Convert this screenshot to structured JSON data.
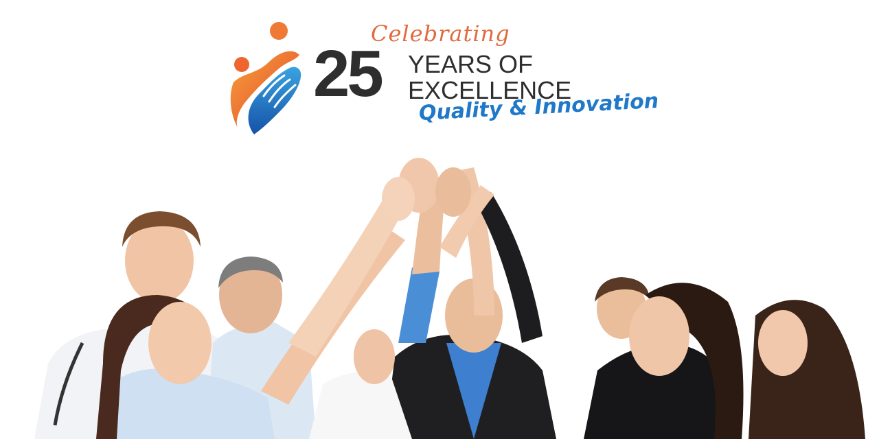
{
  "logo": {
    "script_line": "Celebrating",
    "number": "25",
    "line1": "YEARS OF",
    "line2": "EXCELLENCE",
    "tagline": "Quality & Innovation"
  },
  "colors": {
    "orange": "#e8622e",
    "orange_light": "#f3a23a",
    "blue": "#1f78c8",
    "blue_light": "#3aa3e0",
    "text_dark": "#2e2e2e",
    "script": "#e06a3e"
  },
  "photo": {
    "subject": "group-of-professionals-high-five"
  }
}
